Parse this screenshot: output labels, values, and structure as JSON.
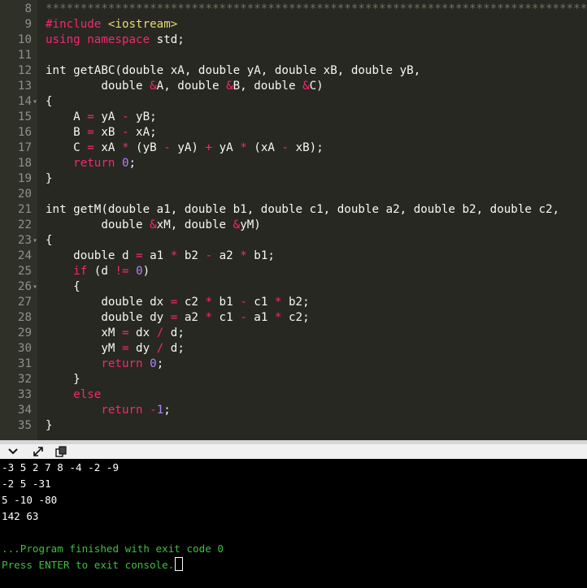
{
  "editor": {
    "lines": [
      {
        "n": "8",
        "fold": "",
        "tokens": [
          [
            "cm",
            "**************************************************************************************"
          ]
        ]
      },
      {
        "n": "9",
        "fold": "",
        "tokens": [
          [
            "pp",
            "#include "
          ],
          [
            "str",
            "<iostream>"
          ]
        ]
      },
      {
        "n": "10",
        "fold": "",
        "tokens": [
          [
            "kw",
            "using "
          ],
          [
            "kw",
            "namespace"
          ],
          [
            "",
            " std;"
          ]
        ]
      },
      {
        "n": "11",
        "fold": "",
        "tokens": []
      },
      {
        "n": "12",
        "fold": "",
        "tokens": [
          [
            "",
            "int getABC(double xA, double yA, double xB, double yB,"
          ]
        ]
      },
      {
        "n": "13",
        "fold": "",
        "tokens": [
          [
            "",
            "        double "
          ],
          [
            "op",
            "&"
          ],
          [
            "",
            "A, double "
          ],
          [
            "op",
            "&"
          ],
          [
            "",
            "B, double "
          ],
          [
            "op",
            "&"
          ],
          [
            "",
            "C)"
          ]
        ]
      },
      {
        "n": "14",
        "fold": "▾",
        "tokens": [
          [
            "",
            "{"
          ]
        ]
      },
      {
        "n": "15",
        "fold": "",
        "tokens": [
          [
            "",
            "    A "
          ],
          [
            "op",
            "="
          ],
          [
            "",
            " yA "
          ],
          [
            "op",
            "-"
          ],
          [
            "",
            " yB;"
          ]
        ]
      },
      {
        "n": "16",
        "fold": "",
        "tokens": [
          [
            "",
            "    B "
          ],
          [
            "op",
            "="
          ],
          [
            "",
            " xB "
          ],
          [
            "op",
            "-"
          ],
          [
            "",
            " xA;"
          ]
        ]
      },
      {
        "n": "17",
        "fold": "",
        "tokens": [
          [
            "",
            "    C "
          ],
          [
            "op",
            "="
          ],
          [
            "",
            " xA "
          ],
          [
            "op",
            "*"
          ],
          [
            "",
            " (yB "
          ],
          [
            "op",
            "-"
          ],
          [
            "",
            " yA) "
          ],
          [
            "op",
            "+"
          ],
          [
            "",
            " yA "
          ],
          [
            "op",
            "*"
          ],
          [
            "",
            " (xA "
          ],
          [
            "op",
            "-"
          ],
          [
            "",
            " xB);"
          ]
        ]
      },
      {
        "n": "18",
        "fold": "",
        "tokens": [
          [
            "",
            "    "
          ],
          [
            "kw",
            "return "
          ],
          [
            "num",
            "0"
          ],
          [
            "",
            ";"
          ]
        ]
      },
      {
        "n": "19",
        "fold": "",
        "tokens": [
          [
            "",
            "}"
          ]
        ]
      },
      {
        "n": "20",
        "fold": "",
        "tokens": []
      },
      {
        "n": "21",
        "fold": "",
        "tokens": [
          [
            "",
            "int getM(double a1, double b1, double c1, double a2, double b2, double c2,"
          ]
        ]
      },
      {
        "n": "22",
        "fold": "",
        "tokens": [
          [
            "",
            "        double "
          ],
          [
            "op",
            "&"
          ],
          [
            "",
            "xM, double "
          ],
          [
            "op",
            "&"
          ],
          [
            "",
            "yM)"
          ]
        ]
      },
      {
        "n": "23",
        "fold": "▾",
        "tokens": [
          [
            "",
            "{"
          ]
        ]
      },
      {
        "n": "24",
        "fold": "",
        "tokens": [
          [
            "",
            "    double d "
          ],
          [
            "op",
            "="
          ],
          [
            "",
            " a1 "
          ],
          [
            "op",
            "*"
          ],
          [
            "",
            " b2 "
          ],
          [
            "op",
            "-"
          ],
          [
            "",
            " a2 "
          ],
          [
            "op",
            "*"
          ],
          [
            "",
            " b1;"
          ]
        ]
      },
      {
        "n": "25",
        "fold": "",
        "tokens": [
          [
            "",
            "    "
          ],
          [
            "kw",
            "if"
          ],
          [
            "",
            " (d "
          ],
          [
            "op",
            "!="
          ],
          [
            "",
            " "
          ],
          [
            "num",
            "0"
          ],
          [
            "",
            ")"
          ]
        ]
      },
      {
        "n": "26",
        "fold": "▾",
        "tokens": [
          [
            "",
            "    {"
          ]
        ]
      },
      {
        "n": "27",
        "fold": "",
        "tokens": [
          [
            "",
            "        double dx "
          ],
          [
            "op",
            "="
          ],
          [
            "",
            " c2 "
          ],
          [
            "op",
            "*"
          ],
          [
            "",
            " b1 "
          ],
          [
            "op",
            "-"
          ],
          [
            "",
            " c1 "
          ],
          [
            "op",
            "*"
          ],
          [
            "",
            " b2;"
          ]
        ]
      },
      {
        "n": "28",
        "fold": "",
        "tokens": [
          [
            "",
            "        double dy "
          ],
          [
            "op",
            "="
          ],
          [
            "",
            " a2 "
          ],
          [
            "op",
            "*"
          ],
          [
            "",
            " c1 "
          ],
          [
            "op",
            "-"
          ],
          [
            "",
            " a1 "
          ],
          [
            "op",
            "*"
          ],
          [
            "",
            " c2;"
          ]
        ]
      },
      {
        "n": "29",
        "fold": "",
        "tokens": [
          [
            "",
            "        xM "
          ],
          [
            "op",
            "="
          ],
          [
            "",
            " dx "
          ],
          [
            "op",
            "/"
          ],
          [
            "",
            " d;"
          ]
        ]
      },
      {
        "n": "30",
        "fold": "",
        "tokens": [
          [
            "",
            "        yM "
          ],
          [
            "op",
            "="
          ],
          [
            "",
            " dy "
          ],
          [
            "op",
            "/"
          ],
          [
            "",
            " d;"
          ]
        ]
      },
      {
        "n": "31",
        "fold": "",
        "tokens": [
          [
            "",
            "        "
          ],
          [
            "kw",
            "return "
          ],
          [
            "num",
            "0"
          ],
          [
            "",
            ";"
          ]
        ]
      },
      {
        "n": "32",
        "fold": "",
        "tokens": [
          [
            "",
            "    }"
          ]
        ]
      },
      {
        "n": "33",
        "fold": "",
        "tokens": [
          [
            "",
            "    "
          ],
          [
            "kw",
            "else"
          ]
        ]
      },
      {
        "n": "34",
        "fold": "",
        "tokens": [
          [
            "",
            "        "
          ],
          [
            "kw",
            "return "
          ],
          [
            "op",
            "-"
          ],
          [
            "num",
            "1"
          ],
          [
            "",
            ";"
          ]
        ]
      },
      {
        "n": "35",
        "fold": "",
        "tokens": [
          [
            "",
            "}"
          ]
        ]
      }
    ]
  },
  "toolbar": {
    "icons": [
      "chevron-down-icon",
      "expand-icon",
      "copy-icon"
    ],
    "glyphs": {
      "collapse": "✔",
      "expand": "⤢",
      "copy": "⎘"
    }
  },
  "console": {
    "lines": [
      {
        "text": "-3 5 2 7 8 -4 -2 -9",
        "style": "normal"
      },
      {
        "text": "-2 5 -31",
        "style": "normal"
      },
      {
        "text": "5 -10 -80",
        "style": "normal"
      },
      {
        "text": "142 63",
        "style": "normal"
      },
      {
        "text": "",
        "style": "normal"
      },
      {
        "text": "...Program finished with exit code 0",
        "style": "green"
      },
      {
        "text": "Press ENTER to exit console.",
        "style": "green"
      }
    ]
  },
  "colors": {
    "editor_bg": "#272822",
    "keyword": "#f92672",
    "string": "#e6db74",
    "number": "#ae81ff",
    "console_green": "#3fbf3f"
  }
}
